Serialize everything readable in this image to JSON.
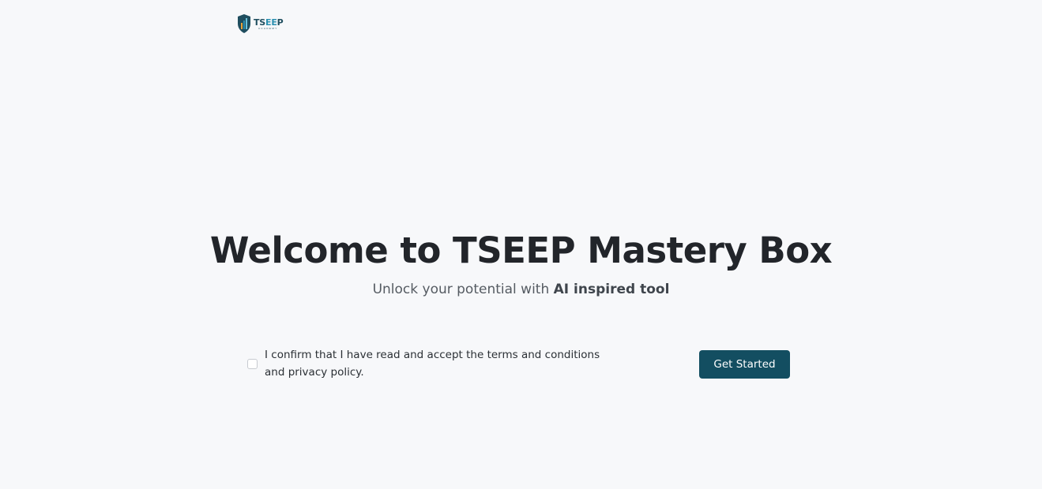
{
  "brand": {
    "logo_text_main": "TS",
    "logo_text_accent": "EE",
    "logo_text_end": "P",
    "logo_subtitle": "ACADEMY",
    "colors": {
      "primary": "#134e61",
      "accent": "#2a8fb0",
      "background": "#f7f8fa"
    }
  },
  "hero": {
    "title": "Welcome to TSEEP Mastery Box",
    "subtitle_prefix": "Unlock your potential with ",
    "subtitle_bold": "AI inspired tool"
  },
  "consent": {
    "checked": false,
    "text": "I confirm that I have read and accept the terms and conditions and privacy policy."
  },
  "actions": {
    "get_started_label": "Get Started"
  },
  "icons": {
    "logo": "shield-logo-icon"
  }
}
